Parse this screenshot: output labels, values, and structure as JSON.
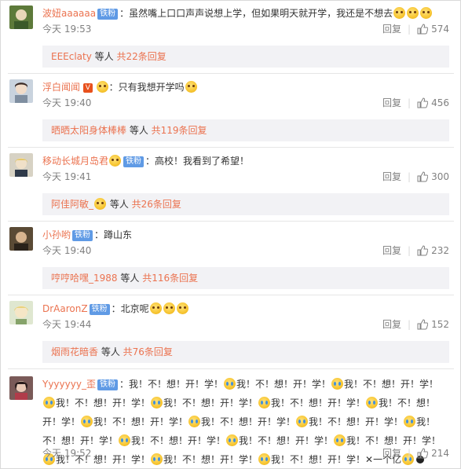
{
  "actions": {
    "reply": "回复"
  },
  "comments": [
    {
      "user": "波妞aaaaaa",
      "badge": "铁粉",
      "text": "：虽然嘴上口口声声说想上学，但如果明天就开学，我还是不想去",
      "time": "今天 19:53",
      "likes": "574",
      "reply_names": "EEEclaty",
      "reply_mid": " 等人 ",
      "reply_count": "共22条回复"
    },
    {
      "user": "浮白闻闻",
      "text": "：只有我想开学吗",
      "time": "今天 19:40",
      "likes": "456",
      "reply_names": "晒晒太阳身体棒棒",
      "reply_mid": " 等人 ",
      "reply_count": "共119条回复"
    },
    {
      "user": "移动长城月岛君",
      "badge": "铁粉",
      "text": "：高校！我看到了希望！",
      "time": "今天 19:41",
      "likes": "300",
      "reply_names": "阿佳阿敏_",
      "reply_mid": " 等人 ",
      "reply_count": "共26条回复"
    },
    {
      "user": "小孙哟",
      "badge": "铁粉",
      "text": "：蹲山东",
      "time": "今天 19:40",
      "likes": "232",
      "reply_names": "哼哼哈嘿_1988",
      "reply_mid": " 等人 ",
      "reply_count": "共116条回复"
    },
    {
      "user": "DrAaronZ",
      "badge": "铁粉",
      "text": "：北京呢",
      "time": "今天 19:44",
      "likes": "152",
      "reply_names": "烟雨花暗香",
      "reply_mid": " 等人 ",
      "reply_count": "共76条回复"
    },
    {
      "user": "Yyyyyyy_歪",
      "badge": "铁粉",
      "text_segments": [
        "：我！不！想！开！学！",
        "我！不！想！开！学！",
        "我！不！想！开！学！",
        "我！不！想！开！学！",
        "我！不！想！开！学！",
        "我！不！想！开！学！",
        "我！不！想！开！学！",
        "我！不！想！开！学！",
        "我！不！想！开！学！",
        "我！不！想！开！学！",
        "我！不！想！开！学！",
        "我！不！想！开！学！",
        "我！不！想！开！学！",
        "我！不！想！开！学！",
        "我！不！想！开！学！",
        "我！不！想！开！学！",
        "我！不！想！开！学！✕一个亿"
      ],
      "time": "今天 19:52",
      "likes": "214"
    }
  ]
}
